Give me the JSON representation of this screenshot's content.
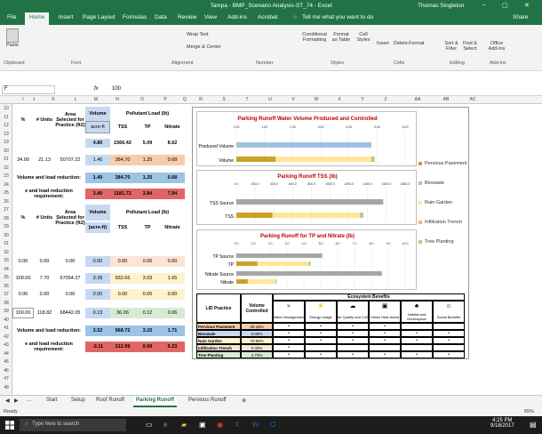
{
  "window": {
    "title": "Tampa - BMP_Scenario Analysis-ST_74  -  Excel",
    "user": "Thomas Singleton"
  },
  "ribbon": {
    "tabs": [
      "File",
      "Home",
      "Insert",
      "Page Layout",
      "Formulas",
      "Data",
      "Review",
      "View",
      "Add-ins",
      "Acrobat"
    ],
    "tell_me": "Tell me what you want to do",
    "share": "Share",
    "groups": [
      "Clipboard",
      "Font",
      "Alignment",
      "Number",
      "Styles",
      "Cells",
      "Editing",
      "Add-ins"
    ],
    "buttons": {
      "paste": "Paste",
      "wrap_text": "Wrap Text",
      "merge_center": "Merge & Center",
      "cond_fmt": "Conditional Formatting",
      "format_as_table": "Format as Table",
      "cell_styles": "Cell Styles",
      "insert": "Insert",
      "delete": "Delete",
      "format": "Format",
      "sort_filter": "Sort & Filter",
      "find_select": "Find & Select",
      "office_addins": "Office Add-ins"
    }
  },
  "formula_bar": {
    "name_box": "F",
    "fx": "fx",
    "value": "100"
  },
  "columns": [
    "",
    "I",
    "J",
    "K",
    "L",
    "M",
    "N",
    "O",
    "P",
    "Q",
    "R",
    "S",
    "T",
    "U",
    "V",
    "W",
    "X",
    "Y",
    "Z",
    "AA",
    "AB",
    "AC"
  ],
  "table1": {
    "h_pct": "%",
    "h_units": "# Units",
    "h_area": "Area Selected for Practice (ft2)",
    "h_volume": "Volume",
    "h_pollutant": "Pollutant Load (lb)",
    "unit_acre": "acre-ft",
    "tss": "TSS",
    "tp": "TP",
    "nitrate": "Nitrate",
    "row12": {
      "vol": "4.80",
      "tss": "1566.42",
      "tp": "5.09",
      "nitrate": "8.62"
    },
    "row19": {
      "pct": "34.00",
      "units": "21.13",
      "area": "50707.22",
      "vol": "1.40",
      "tss": "384.70",
      "tp": "1.25",
      "nitrate": "0.68"
    },
    "red_label": "Volume and load reduction:",
    "red_vals": {
      "vol": "1.40",
      "tss": "384.70",
      "tp": "1.25",
      "nitrate": "0.68"
    },
    "req_label": "e and load reduction requirement:",
    "req_vals": {
      "vol": "3.40",
      "tss": "1181.72",
      "tp": "3.84",
      "nitrate": "7.94"
    }
  },
  "table2": {
    "h_pct": "%",
    "h_units": "# Units",
    "h_area": "Area Selected for Practice (ft2)",
    "h_volume": "Volume",
    "h_pollutant": "Pollutant Load (lb)",
    "unit_acre": "(acre-ft)",
    "tss": "TSS",
    "tp": "TP",
    "nitrate": "Nitrate",
    "rows": [
      {
        "pct": "0.00",
        "units": "0.00",
        "area": "0.00",
        "vol": "0.00",
        "tss": "0.00",
        "tp": "0.00",
        "nitrate": "0.00"
      },
      {
        "pct": "100.00",
        "units": "7.70",
        "area": "67054.27",
        "vol": "3.39",
        "tss": "932.66",
        "tp": "3.03",
        "nitrate": "1.65"
      },
      {
        "pct": "0.00",
        "units": "0.00",
        "area": "0.00",
        "vol": "0.00",
        "tss": "0.00",
        "tp": "0.00",
        "nitrate": "0.00"
      },
      {
        "pct": "100.00",
        "units": "118.82",
        "area": "68442.05",
        "vol": "0.13",
        "tss": "36.06",
        "tp": "0.12",
        "nitrate": "0.06"
      }
    ],
    "red_label": "Volume and load reduction:",
    "red_vals": {
      "vol": "3.52",
      "tss": "968.72",
      "tp": "3.15",
      "nitrate": "1.71"
    },
    "req_label": "e and load reduction requirement:",
    "req_vals": {
      "vol": "-0.11",
      "tss": "212.99",
      "tp": "0.69",
      "nitrate": "6.23"
    }
  },
  "row_numbers": [
    "10",
    "11",
    "12",
    "13",
    "19",
    "20",
    "21",
    "22",
    "23",
    "24",
    "25",
    "26",
    "27",
    "28",
    "29",
    "30",
    "31",
    "32",
    "33",
    "34",
    "35",
    "36",
    "37",
    "38",
    "39",
    "40",
    "41",
    "42",
    "43",
    "44",
    "45",
    "46",
    "47",
    "48"
  ],
  "chart1": {
    "title": "Parking Runoff  Water Volume Produced and Controlled",
    "ticks": [
      "0.00",
      "1.00",
      "2.00",
      "3.00",
      "4.00",
      "5.00",
      "6.00"
    ],
    "categories": [
      "Produced Volume",
      "Volume"
    ]
  },
  "chart2": {
    "title": "Parking Runoff TSS (lb)",
    "ticks": [
      "0.0",
      "200.0",
      "400.0",
      "600.0",
      "800.0",
      "1000.0",
      "1200.0",
      "1400.0",
      "1600.0",
      "1800.0"
    ],
    "categories": [
      "TSS Source",
      "TSS"
    ]
  },
  "chart3": {
    "title": "Parking Runoff for TP and Nitrate (lb)",
    "ticks": [
      "0.0",
      "1.0",
      "2.0",
      "3.0",
      "4.0",
      "5.0",
      "6.0",
      "7.0",
      "8.0",
      "9.0",
      "10.0"
    ],
    "categories": [
      "TP Source",
      "TP",
      "Nitrate Source",
      "Nitrate"
    ]
  },
  "legend": [
    "Pervious Pavement",
    "Bioswale",
    "Rain Garden",
    "Infiltration Trench",
    "Tree Planting"
  ],
  "legend_colors": [
    "#c9a227",
    "#9dc3e6",
    "#ffe699",
    "#f4b183",
    "#a9d18e"
  ],
  "benefits": {
    "h_practice": "LID Practice",
    "h_vol": "Volume Controlled",
    "h_eco": "Ecosystem Benefits",
    "cols": [
      "Water Management",
      "Energy Usage",
      "Air Quality and Co2",
      "Urban Heat Island",
      "Habitat and Greenspace",
      "Social Benefits"
    ],
    "rows": [
      {
        "name": "Pervious Pavement",
        "pct": "29.15%",
        "marks": [
          "•",
          "•",
          "•",
          "•",
          "",
          ""
        ]
      },
      {
        "name": "Bioswale",
        "pct": "0.00%",
        "marks": [
          "•",
          "•",
          "•",
          "•",
          "•",
          "•"
        ]
      },
      {
        "name": "Rain Garden",
        "pct": "70.55%",
        "marks": [
          "•",
          "•",
          "•",
          "•",
          "•",
          "•"
        ]
      },
      {
        "name": "Infiltration Trench",
        "pct": "0.00%",
        "marks": [
          "•",
          "",
          "",
          "",
          "",
          ""
        ]
      },
      {
        "name": "Tree Planting",
        "pct": "2.73%",
        "marks": [
          "•",
          "•",
          "•",
          "•",
          "•",
          "•"
        ]
      }
    ]
  },
  "sheet_tabs": [
    "Start",
    "Setup",
    "Roof Runoff",
    "Parking Runoff",
    "Pervious Runoff"
  ],
  "status": {
    "ready": "Ready",
    "zoom": "65%"
  },
  "taskbar": {
    "search": "Type here to search",
    "time": "4:25 PM",
    "date": "9/18/2017"
  }
}
